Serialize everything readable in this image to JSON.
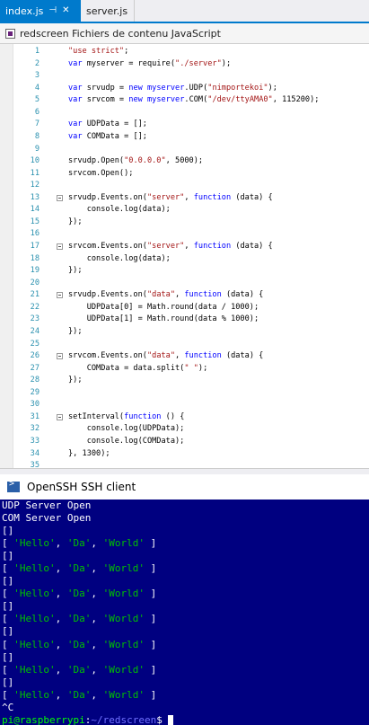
{
  "tabs": [
    {
      "label": "index.js",
      "active": true,
      "pin": "pin-icon",
      "close": "close-icon"
    },
    {
      "label": "server.js",
      "active": false
    }
  ],
  "navbar": {
    "label": "redscreen Fichiers de contenu JavaScript"
  },
  "editor": {
    "lines": [
      {
        "n": "1",
        "tokens": [
          [
            "str",
            "\"use strict\""
          ],
          [
            "plain",
            ";"
          ]
        ]
      },
      {
        "n": "2",
        "tokens": [
          [
            "kw",
            "var"
          ],
          [
            "plain",
            " myserver = require("
          ],
          [
            "str",
            "\"./server\""
          ],
          [
            "plain",
            ");"
          ]
        ]
      },
      {
        "n": "3",
        "tokens": []
      },
      {
        "n": "4",
        "tokens": [
          [
            "kw",
            "var"
          ],
          [
            "plain",
            " srvudp = "
          ],
          [
            "kw",
            "new"
          ],
          [
            "plain",
            " "
          ],
          [
            "kw",
            "myserver"
          ],
          [
            "plain",
            ".UDP("
          ],
          [
            "str",
            "\"nimportekoi\""
          ],
          [
            "plain",
            ");"
          ]
        ]
      },
      {
        "n": "5",
        "tokens": [
          [
            "kw",
            "var"
          ],
          [
            "plain",
            " srvcom = "
          ],
          [
            "kw",
            "new"
          ],
          [
            "plain",
            " "
          ],
          [
            "kw",
            "myserver"
          ],
          [
            "plain",
            ".COM("
          ],
          [
            "str",
            "\"/dev/ttyAMA0\""
          ],
          [
            "plain",
            ", 115200);"
          ]
        ]
      },
      {
        "n": "6",
        "tokens": []
      },
      {
        "n": "7",
        "tokens": [
          [
            "kw",
            "var"
          ],
          [
            "plain",
            " UDPData = [];"
          ]
        ]
      },
      {
        "n": "8",
        "tokens": [
          [
            "kw",
            "var"
          ],
          [
            "plain",
            " COMData = [];"
          ]
        ]
      },
      {
        "n": "9",
        "tokens": []
      },
      {
        "n": "10",
        "tokens": [
          [
            "plain",
            "srvudp.Open("
          ],
          [
            "str",
            "\"0.0.0.0\""
          ],
          [
            "plain",
            ", 5000);"
          ]
        ]
      },
      {
        "n": "11",
        "tokens": [
          [
            "plain",
            "srvcom.Open();"
          ]
        ]
      },
      {
        "n": "12",
        "tokens": []
      },
      {
        "n": "13",
        "fold": true,
        "tokens": [
          [
            "plain",
            "srvudp.Events.on("
          ],
          [
            "str",
            "\"server\""
          ],
          [
            "plain",
            ", "
          ],
          [
            "kw",
            "function"
          ],
          [
            "plain",
            " (data) {"
          ]
        ]
      },
      {
        "n": "14",
        "tokens": [
          [
            "plain",
            "    console.log(data);"
          ]
        ]
      },
      {
        "n": "15",
        "tokens": [
          [
            "plain",
            "});"
          ]
        ]
      },
      {
        "n": "16",
        "tokens": []
      },
      {
        "n": "17",
        "fold": true,
        "tokens": [
          [
            "plain",
            "srvcom.Events.on("
          ],
          [
            "str",
            "\"server\""
          ],
          [
            "plain",
            ", "
          ],
          [
            "kw",
            "function"
          ],
          [
            "plain",
            " (data) {"
          ]
        ]
      },
      {
        "n": "18",
        "tokens": [
          [
            "plain",
            "    console.log(data);"
          ]
        ]
      },
      {
        "n": "19",
        "tokens": [
          [
            "plain",
            "});"
          ]
        ]
      },
      {
        "n": "20",
        "tokens": []
      },
      {
        "n": "21",
        "fold": true,
        "tokens": [
          [
            "plain",
            "srvudp.Events.on("
          ],
          [
            "str",
            "\"data\""
          ],
          [
            "plain",
            ", "
          ],
          [
            "kw",
            "function"
          ],
          [
            "plain",
            " (data) {"
          ]
        ]
      },
      {
        "n": "22",
        "tokens": [
          [
            "plain",
            "    UDPData[0] = Math.round(data / 1000);"
          ]
        ]
      },
      {
        "n": "23",
        "tokens": [
          [
            "plain",
            "    UDPData[1] = Math.round(data % 1000);"
          ]
        ]
      },
      {
        "n": "24",
        "tokens": [
          [
            "plain",
            "});"
          ]
        ]
      },
      {
        "n": "25",
        "tokens": []
      },
      {
        "n": "26",
        "fold": true,
        "tokens": [
          [
            "plain",
            "srvcom.Events.on("
          ],
          [
            "str",
            "\"data\""
          ],
          [
            "plain",
            ", "
          ],
          [
            "kw",
            "function"
          ],
          [
            "plain",
            " (data) {"
          ]
        ]
      },
      {
        "n": "27",
        "tokens": [
          [
            "plain",
            "    COMData = data.split("
          ],
          [
            "str",
            "\" \""
          ],
          [
            "plain",
            ");"
          ]
        ]
      },
      {
        "n": "28",
        "tokens": [
          [
            "plain",
            "});"
          ]
        ]
      },
      {
        "n": "29",
        "tokens": []
      },
      {
        "n": "30",
        "tokens": []
      },
      {
        "n": "31",
        "fold": true,
        "tokens": [
          [
            "plain",
            "setInterval("
          ],
          [
            "kw",
            "function"
          ],
          [
            "plain",
            " () {"
          ]
        ]
      },
      {
        "n": "32",
        "tokens": [
          [
            "plain",
            "    console.log(UDPData);"
          ]
        ]
      },
      {
        "n": "33",
        "tokens": [
          [
            "plain",
            "    console.log(COMData);"
          ]
        ]
      },
      {
        "n": "34",
        "tokens": [
          [
            "plain",
            "}, 1300);"
          ]
        ]
      },
      {
        "n": "35",
        "tokens": []
      }
    ]
  },
  "terminal": {
    "title": "OpenSSH SSH client",
    "icon": "terminal-icon",
    "lines": [
      [
        [
          "w",
          "UDP Server Open"
        ]
      ],
      [
        [
          "w",
          "COM Server Open"
        ]
      ],
      [
        [
          "w",
          "[]"
        ]
      ],
      [
        [
          "w",
          "[ "
        ],
        [
          "g",
          "'Hello'"
        ],
        [
          "w",
          ", "
        ],
        [
          "g",
          "'Da'"
        ],
        [
          "w",
          ", "
        ],
        [
          "g",
          "'World'"
        ],
        [
          "w",
          " ]"
        ]
      ],
      [
        [
          "w",
          "[]"
        ]
      ],
      [
        [
          "w",
          "[ "
        ],
        [
          "g",
          "'Hello'"
        ],
        [
          "w",
          ", "
        ],
        [
          "g",
          "'Da'"
        ],
        [
          "w",
          ", "
        ],
        [
          "g",
          "'World'"
        ],
        [
          "w",
          " ]"
        ]
      ],
      [
        [
          "w",
          "[]"
        ]
      ],
      [
        [
          "w",
          "[ "
        ],
        [
          "g",
          "'Hello'"
        ],
        [
          "w",
          ", "
        ],
        [
          "g",
          "'Da'"
        ],
        [
          "w",
          ", "
        ],
        [
          "g",
          "'World'"
        ],
        [
          "w",
          " ]"
        ]
      ],
      [
        [
          "w",
          "[]"
        ]
      ],
      [
        [
          "w",
          "[ "
        ],
        [
          "g",
          "'Hello'"
        ],
        [
          "w",
          ", "
        ],
        [
          "g",
          "'Da'"
        ],
        [
          "w",
          ", "
        ],
        [
          "g",
          "'World'"
        ],
        [
          "w",
          " ]"
        ]
      ],
      [
        [
          "w",
          "[]"
        ]
      ],
      [
        [
          "w",
          "[ "
        ],
        [
          "g",
          "'Hello'"
        ],
        [
          "w",
          ", "
        ],
        [
          "g",
          "'Da'"
        ],
        [
          "w",
          ", "
        ],
        [
          "g",
          "'World'"
        ],
        [
          "w",
          " ]"
        ]
      ],
      [
        [
          "w",
          "[]"
        ]
      ],
      [
        [
          "w",
          "[ "
        ],
        [
          "g",
          "'Hello'"
        ],
        [
          "w",
          ", "
        ],
        [
          "g",
          "'Da'"
        ],
        [
          "w",
          ", "
        ],
        [
          "g",
          "'World'"
        ],
        [
          "w",
          " ]"
        ]
      ],
      [
        [
          "w",
          "[]"
        ]
      ],
      [
        [
          "w",
          "[ "
        ],
        [
          "g",
          "'Hello'"
        ],
        [
          "w",
          ", "
        ],
        [
          "g",
          "'Da'"
        ],
        [
          "w",
          ", "
        ],
        [
          "g",
          "'World'"
        ],
        [
          "w",
          " ]"
        ]
      ],
      [
        [
          "w",
          "^C"
        ]
      ],
      [
        [
          "p",
          "pi@raspberrypi"
        ],
        [
          "w",
          ":"
        ],
        [
          "b",
          "~/redscreen"
        ],
        [
          "w",
          "$ "
        ]
      ]
    ]
  }
}
